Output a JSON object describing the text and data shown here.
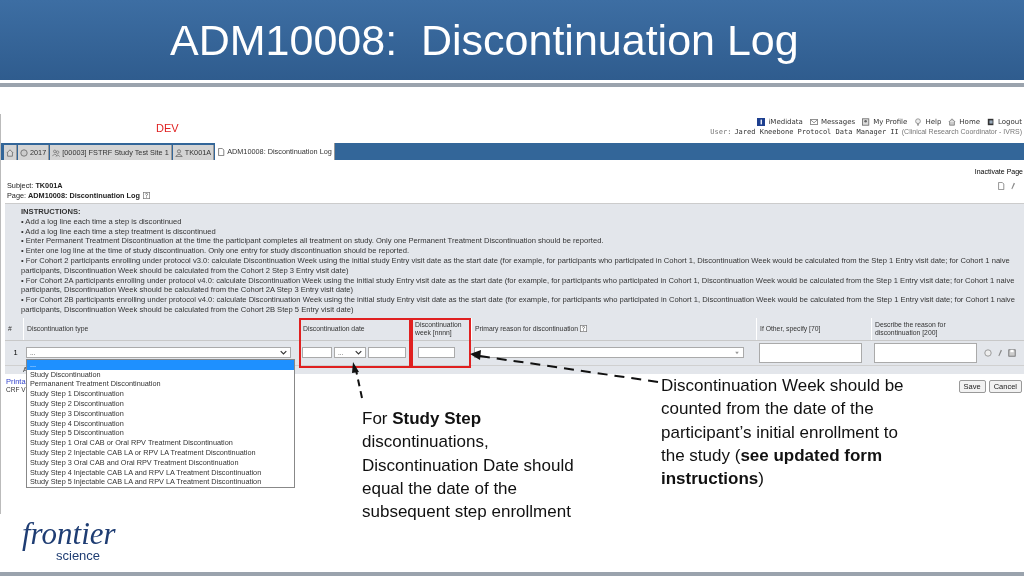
{
  "slide_title": "ADM10008:  Discontinuation Log",
  "app": {
    "env_label": "DEV",
    "top_links": [
      {
        "label": "iMedidata",
        "kind": "imedidata"
      },
      {
        "label": "Messages",
        "kind": "mail"
      },
      {
        "label": "My Profile",
        "kind": "profile"
      },
      {
        "label": "Help",
        "kind": "help"
      },
      {
        "label": "Home",
        "kind": "home"
      },
      {
        "label": "Logout",
        "kind": "logout"
      }
    ],
    "user": {
      "label": "User:",
      "name": "Jared Kneebone Protocol Data Manager II",
      "role": "(Clinical Research Coordinator - IVRS)"
    },
    "tabs": [
      {
        "kind": "home",
        "selected": false
      },
      {
        "label": "2017",
        "kind": "globe",
        "selected": false
      },
      {
        "label": "[00003] FSTRF Study Test Site 1",
        "kind": "people",
        "selected": false
      },
      {
        "label": "TK001A",
        "kind": "person",
        "selected": false
      },
      {
        "label": "ADM10008: Discontinuation Log",
        "kind": "doc",
        "selected": true
      }
    ],
    "subject": {
      "label": "Subject:",
      "value": "TK001A"
    },
    "page": {
      "label": "Page:",
      "value": "ADM10008: Discontinuation Log"
    },
    "inactivate_link": "Inactivate Page",
    "instructions": {
      "heading": "INSTRUCTIONS:",
      "items": [
        "• Add a log line each time a step is discontinued",
        "• Add a log line each time a step treatment is discontinued",
        "• Enter Permanent Treatment Discontinuation at the time the participant completes all treatment on study. Only one Permanent Treatment Discontinuation should be reported.",
        "• Enter one log line at the time of study discontinuation. Only one entry for study discontinuation should be reported.",
        "• For Cohort 2 participants enrolling under protocol v3.0: calculate Discontinuation Week using the initial study Entry visit date as the start date (for example, for participants who participated in Cohort 1, Discontinuation Week would be calculated from the Step 1 Entry visit date; for Cohort 1 naive participants, Discontinuation Week should be calculated from the Cohort 2 Step 3 Entry visit date)",
        "• For Cohort 2A participants enrolling under protocol v4.0: calculate Discontinuation Week using the initial study Entry visit date as the start date (for example, for participants who participated in Cohort 1, Discontinuation Week would be calculated from the Step 1 Entry visit date; for Cohort 1 naive participants, Discontinuation Week should be calculated from the Cohort 2A Step 3 Entry visit date)",
        "• For Cohort 2B participants enrolling under protocol v4.0: calculate Discontinuation Week using the initial study Entry visit date as the start date (for example, for participants who participated in Cohort 1, Discontinuation Week would be calculated from the Step 1 Entry visit date; for Cohort 1 naive participants, Discontinuation Week should be calculated from the Cohort 2B Step 5 Entry visit date)"
      ]
    },
    "table": {
      "columns": [
        "#",
        "Discontinuation type",
        "Discontinuation date",
        "Discontinuation week [nnnn]",
        "Primary reason for discontinuation",
        "If Other, specify [70]",
        "Describe the reason for discontinuation [200]"
      ],
      "row": {
        "number": "1",
        "type_value": "...",
        "month_value": "..."
      }
    },
    "type_options": [
      {
        "label": "...",
        "selected": true
      },
      {
        "label": "Study Discontinuation",
        "selected": false
      },
      {
        "label": "Permananent Treatment Discontinuation",
        "selected": false
      },
      {
        "label": "Study Step 1 Discontinuation",
        "selected": false
      },
      {
        "label": "Study Step 2 Discontinuation",
        "selected": false
      },
      {
        "label": "Study Step 3 Discontinuation",
        "selected": false
      },
      {
        "label": "Study Step 4 Discontinuation",
        "selected": false
      },
      {
        "label": "Study Step 5 Discontinuation",
        "selected": false
      },
      {
        "label": "Study Step 1 Oral CAB or Oral RPV Treatment Discontinuation",
        "selected": false
      },
      {
        "label": "Study Step 2 Injectable CAB LA or RPV LA Treatment Discontinuation",
        "selected": false
      },
      {
        "label": "Study Step 3 Oral CAB and Oral RPV Treatment Discontinuation",
        "selected": false
      },
      {
        "label": "Study Step 4 Injectable CAB LA and RPV LA Treatment Discontinuation",
        "selected": false
      },
      {
        "label": "Study Step 5 Injectable CAB LA and RPV LA Treatment Discontinuation",
        "selected": false
      }
    ],
    "partial_texts": {
      "row_below": "A",
      "printable_link": "Printa",
      "crf_version": "CRF V"
    },
    "buttons": [
      "Save",
      "Cancel"
    ]
  },
  "callouts": [
    "For **Study Step** discontinuations, Discontinuation Date should equal the date of the subsequent step enrollment",
    "Discontinuation Week should be counted from the date of the participant’s initial enrollment to the study (**see updated form instructions**)"
  ],
  "logo": {
    "main": "frontier",
    "sub": "science"
  }
}
